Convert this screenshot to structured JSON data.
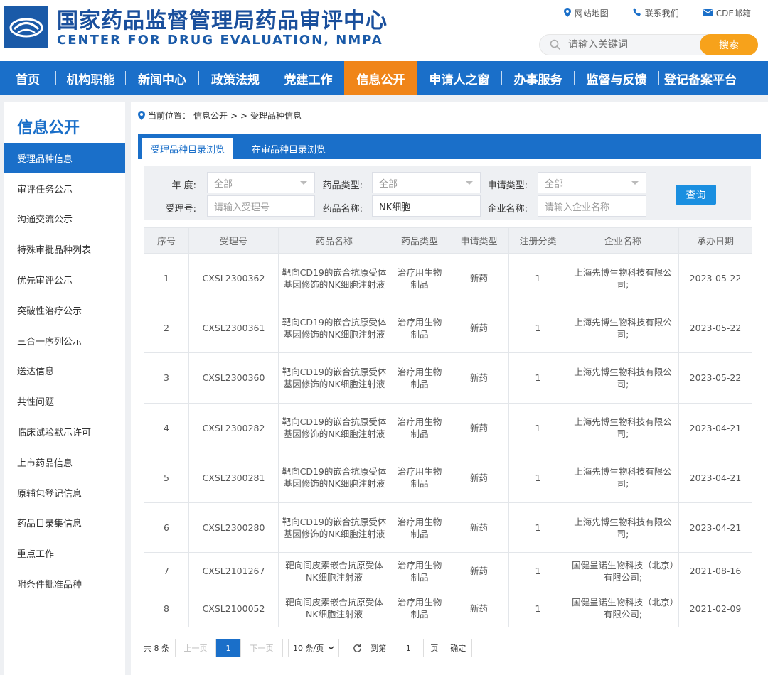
{
  "header": {
    "title_cn": "国家药品监督管理局药品审评中心",
    "title_en": "CENTER FOR DRUG EVALUATION, NMPA",
    "links": [
      {
        "label": "网站地图",
        "icon": "location-icon"
      },
      {
        "label": "联系我们",
        "icon": "phone-icon"
      },
      {
        "label": "CDE邮箱",
        "icon": "mail-icon"
      }
    ],
    "search": {
      "placeholder": "请输入关键词",
      "button": "搜索"
    }
  },
  "nav": {
    "items": [
      "首页",
      "机构职能",
      "新闻中心",
      "政策法规",
      "党建工作",
      "信息公开",
      "申请人之窗",
      "办事服务",
      "监督与反馈",
      "登记备案平台"
    ],
    "active": "信息公开"
  },
  "sidebar": {
    "title": "信息公开",
    "items": [
      "受理品种信息",
      "审评任务公示",
      "沟通交流公示",
      "特殊审批品种列表",
      "优先审评公示",
      "突破性治疗公示",
      "三合一序列公示",
      "送达信息",
      "共性问题",
      "临床试验默示许可",
      "上市药品信息",
      "原辅包登记信息",
      "药品目录集信息",
      "重点工作",
      "附条件批准品种"
    ],
    "active": "受理品种信息"
  },
  "breadcrumb": {
    "prefix": "当前位置：",
    "section": "信息公开",
    "sep": "> >",
    "page": "受理品种信息"
  },
  "tabs": {
    "items": [
      "受理品种目录浏览",
      "在审品种目录浏览"
    ],
    "active": "受理品种目录浏览"
  },
  "filters": {
    "year_label": "年    度:",
    "year_value": "全部",
    "drug_type_label": "药品类型:",
    "drug_type_value": "全部",
    "apply_type_label": "申请类型:",
    "apply_type_value": "全部",
    "accept_no_label": "受理号:",
    "accept_no_placeholder": "请输入受理号",
    "drug_name_label": "药品名称:",
    "drug_name_value": "NK细胞",
    "company_label": "企业名称:",
    "company_placeholder": "请输入企业名称",
    "query_button": "查询"
  },
  "table": {
    "columns": [
      "序号",
      "受理号",
      "药品名称",
      "药品类型",
      "申请类型",
      "注册分类",
      "企业名称",
      "承办日期"
    ],
    "rows": [
      {
        "no": "1",
        "accept_no": "CXSL2300362",
        "name": "靶向CD19的嵌合抗原受体基因修饰的NK细胞注射液",
        "type": "治疗用生物制品",
        "apply": "新药",
        "cls": "1",
        "company": "上海先博生物科技有限公司;",
        "date": "2023-05-22"
      },
      {
        "no": "2",
        "accept_no": "CXSL2300361",
        "name": "靶向CD19的嵌合抗原受体基因修饰的NK细胞注射液",
        "type": "治疗用生物制品",
        "apply": "新药",
        "cls": "1",
        "company": "上海先博生物科技有限公司;",
        "date": "2023-05-22"
      },
      {
        "no": "3",
        "accept_no": "CXSL2300360",
        "name": "靶向CD19的嵌合抗原受体基因修饰的NK细胞注射液",
        "type": "治疗用生物制品",
        "apply": "新药",
        "cls": "1",
        "company": "上海先博生物科技有限公司;",
        "date": "2023-05-22"
      },
      {
        "no": "4",
        "accept_no": "CXSL2300282",
        "name": "靶向CD19的嵌合抗原受体基因修饰的NK细胞注射液",
        "type": "治疗用生物制品",
        "apply": "新药",
        "cls": "1",
        "company": "上海先博生物科技有限公司;",
        "date": "2023-04-21"
      },
      {
        "no": "5",
        "accept_no": "CXSL2300281",
        "name": "靶向CD19的嵌合抗原受体基因修饰的NK细胞注射液",
        "type": "治疗用生物制品",
        "apply": "新药",
        "cls": "1",
        "company": "上海先博生物科技有限公司;",
        "date": "2023-04-21"
      },
      {
        "no": "6",
        "accept_no": "CXSL2300280",
        "name": "靶向CD19的嵌合抗原受体基因修饰的NK细胞注射液",
        "type": "治疗用生物制品",
        "apply": "新药",
        "cls": "1",
        "company": "上海先博生物科技有限公司;",
        "date": "2023-04-21"
      },
      {
        "no": "7",
        "accept_no": "CXSL2101267",
        "name": "靶向间皮素嵌合抗原受体NK细胞注射液",
        "type": "治疗用生物制品",
        "apply": "新药",
        "cls": "1",
        "company": "国健呈诺生物科技（北京）有限公司;",
        "date": "2021-08-16"
      },
      {
        "no": "8",
        "accept_no": "CXSL2100052",
        "name": "靶向间皮素嵌合抗原受体NK细胞注射液",
        "type": "治疗用生物制品",
        "apply": "新药",
        "cls": "1",
        "company": "国健呈诺生物科技（北京）有限公司;",
        "date": "2021-02-09"
      }
    ]
  },
  "pager": {
    "total": "共 8 条",
    "prev": "上一页",
    "current": "1",
    "next": "下一页",
    "page_size": "10 条/页",
    "goto_label": "到第",
    "goto_value": "1",
    "page_unit": "页",
    "confirm": "确定"
  },
  "colors": {
    "primary": "#1a6fc9",
    "accent": "#f08519",
    "search_btn": "#f7a21b"
  }
}
